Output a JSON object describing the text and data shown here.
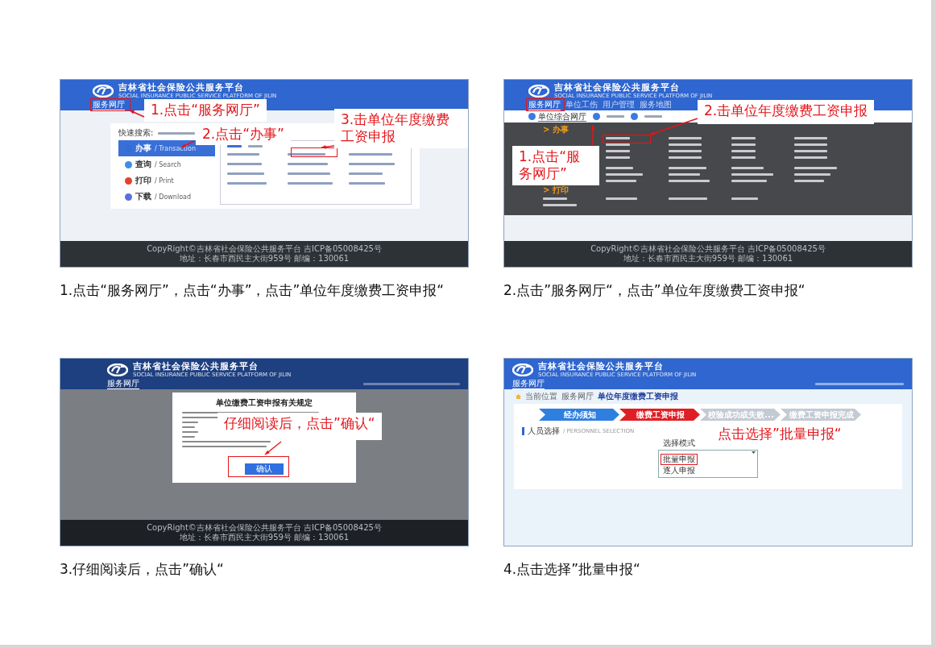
{
  "steps": [
    {
      "kind": "home",
      "header": {
        "title": "吉林省社会保险公共服务平台",
        "subtitle": "SOCIAL INSURANCE PUBLIC SERVICE PLATFORM OF JILIN"
      },
      "nav": [
        {
          "label": "服务网厅",
          "selected": true
        }
      ],
      "quick_search": "快速搜索:",
      "menu": [
        {
          "label": "办事",
          "en": "/ Transaction",
          "selected": true,
          "color": "#2f6fd6"
        },
        {
          "label": "查询",
          "en": "/ Search",
          "selected": false,
          "color": "#3d8ee6"
        },
        {
          "label": "打印",
          "en": "/ Print",
          "selected": false,
          "color": "#e5412d"
        },
        {
          "label": "下载",
          "en": "/ Download",
          "selected": false,
          "color": "#5b6fe0"
        }
      ],
      "footer": [
        "CopyRight©吉林省社会保险公共服务平台 吉ICP备05008425号",
        "地址：长春市西民主大街959号 邮编：130061"
      ],
      "callouts": [
        "1.点击“服务网厅”",
        "2.点击“办事”",
        "3.击单位年度缴费工资申报"
      ],
      "caption": "1.点击“服务网厅”，点击“办事”，点击”单位年度缴费工资申报“"
    },
    {
      "kind": "menu",
      "header": {
        "title": "吉林省社会保险公共服务平台",
        "subtitle": "SOCIAL INSURANCE PUBLIC SERVICE PLATFORM OF JILIN"
      },
      "nav": [
        {
          "label": "服务网厅",
          "selected": true
        },
        {
          "label": "单位工伤",
          "selected": false
        },
        {
          "label": "用户管理",
          "selected": false
        },
        {
          "label": "服务地图",
          "selected": false
        }
      ],
      "subtabs": [
        {
          "label": "单位综合网厅",
          "selected": true
        }
      ],
      "sections": [
        {
          "title": "> 办事"
        },
        {
          "title": "> 打印"
        }
      ],
      "footer": [
        "CopyRight©吉林省社会保险公共服务平台 吉ICP备05008425号",
        "地址：长春市西民主大街959号 邮编：130061"
      ],
      "callouts": [
        "2.击单位年度缴费工资申报",
        "1.点击“服务网厅”"
      ],
      "caption": "2.点击”服务网厅“，点击”单位年度缴费工资申报“"
    },
    {
      "kind": "notice",
      "header": {
        "title": "吉林省社会保险公共服务平台",
        "subtitle": "SOCIAL INSURANCE PUBLIC SERVICE PLATFORM OF JILIN"
      },
      "nav": [
        {
          "label": "服务网厅",
          "selected": true
        }
      ],
      "modal": {
        "title": "单位缴费工资申报有关规定",
        "button": "确认"
      },
      "footer": [
        "CopyRight©吉林省社会保险公共服务平台 吉ICP备05008425号",
        "地址：长春市西民主大街959号 邮编：130061"
      ],
      "callouts": [
        "仔细阅读后，点击”确认“"
      ],
      "caption": "3.仔细阅读后，点击”确认“"
    },
    {
      "kind": "form",
      "header": {
        "title": "吉林省社会保险公共服务平台",
        "subtitle": "SOCIAL INSURANCE PUBLIC SERVICE PLATFORM OF JILIN"
      },
      "nav": [
        {
          "label": "服务网厅",
          "selected": true
        }
      ],
      "breadcrumb": [
        "当前位置",
        "服务网厅",
        "单位年度缴费工资申报"
      ],
      "progress": [
        {
          "label": "经办须知",
          "kind": "done"
        },
        {
          "label": "缴费工资申报",
          "kind": "current"
        },
        {
          "label": "校验成功或失败...",
          "kind": "pending"
        },
        {
          "label": "缴费工资申报完成",
          "kind": "pending"
        }
      ],
      "section": {
        "title": "人员选择",
        "en": "/ PERSONNEL SELECTION"
      },
      "field_label": "选择模式",
      "options": [
        {
          "label": "批量申报",
          "selected": true
        },
        {
          "label": "逐人申报",
          "selected": false
        }
      ],
      "callouts": [
        "点击选择”批量申报“"
      ],
      "caption": "4.点击选择”批量申报“"
    }
  ]
}
